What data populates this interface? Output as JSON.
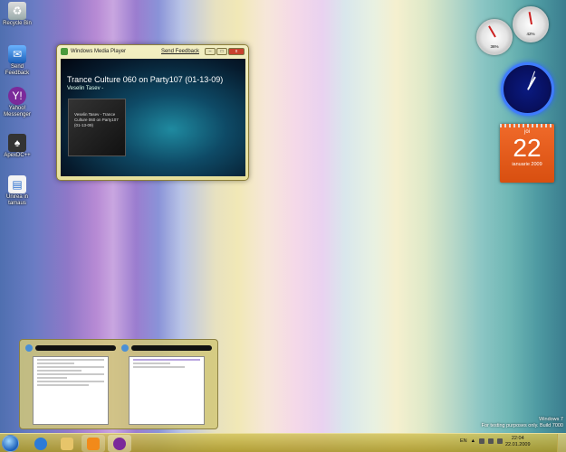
{
  "desktop_icons": [
    {
      "label": "Recycle Bin",
      "icon": "recycle-bin-icon"
    },
    {
      "label": "Send Feedback",
      "icon": "feedback-icon"
    },
    {
      "label": "Yahoo! Messenger",
      "icon": "yahoo-messenger-icon"
    },
    {
      "label": "ApexDC++",
      "icon": "apexdc-icon"
    },
    {
      "label": "Unirea in tamaus",
      "icon": "document-icon"
    }
  ],
  "wmp": {
    "title": "Windows Media Player",
    "feedback_link": "Send Feedback",
    "track_title": "Trance Culture 060 on Party107 (01-13-09)",
    "artist": "Veselin Tasev -",
    "album_art_text": "Veselin Tasev - Trance Culture 060 on Party107 (01-13-09)"
  },
  "gadgets": {
    "cpu_percent": "36%",
    "mem_percent": "42%",
    "calendar": {
      "weekday": "joi",
      "day": "22",
      "month_year": "ianuarie 2009"
    }
  },
  "watermark": {
    "line1": "Windows 7",
    "line2": "For testing purposes only. Build 7000"
  },
  "taskbar": {
    "language": "EN",
    "time": "22:04",
    "date": "22.01.2009",
    "buttons": [
      {
        "name": "internet-explorer-icon",
        "color": "#2d7bd8"
      },
      {
        "name": "windows-explorer-icon",
        "color": "#e7c56a"
      },
      {
        "name": "windows-media-player-icon",
        "color": "#f28a1a"
      },
      {
        "name": "yahoo-messenger-taskbar-icon",
        "color": "#7b2a9a"
      }
    ]
  }
}
